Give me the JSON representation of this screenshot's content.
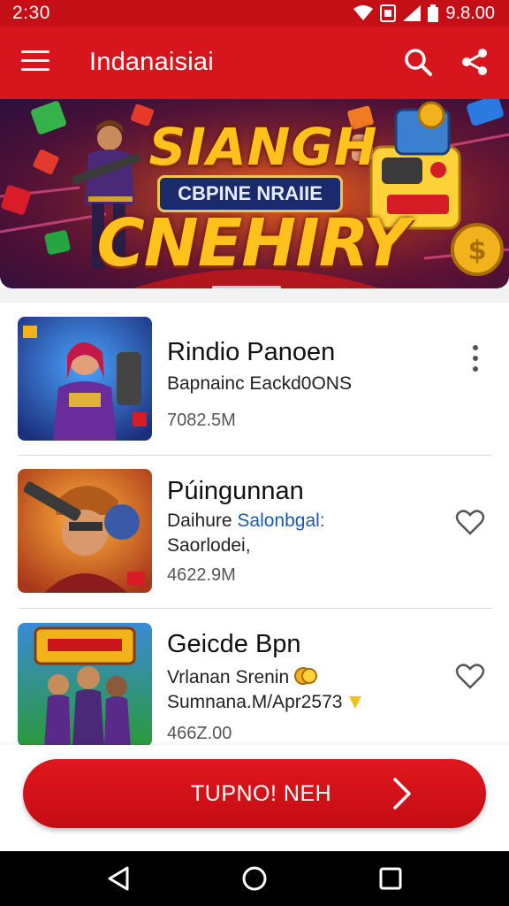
{
  "status_bar": {
    "time": "2:30",
    "battery_text": "9.8.00",
    "icons": [
      "wifi-icon",
      "sim-icon",
      "signal-icon",
      "battery-icon"
    ]
  },
  "app_bar": {
    "title": "Indanaisiai",
    "icons": [
      "menu-icon",
      "search-icon",
      "share-icon"
    ]
  },
  "banner": {
    "title_top": "SIANGH",
    "subtitle": "CBPINE NRAIIE",
    "title_bottom": "CNEHIRY"
  },
  "list": {
    "items": [
      {
        "title": "Rindio Panoen",
        "line1": "Bapnainc Eackd0ONS",
        "line2": "",
        "size": "7082.5M",
        "action": "more-vertical-icon"
      },
      {
        "title": "Púingunnan",
        "line1_a": "Daihure",
        "line1_b": "Salonbgal:",
        "line2": "Saorlodei,",
        "size": "4622.9M",
        "action": "heart-outline-icon"
      },
      {
        "title": "Geicde Bpn",
        "line1": "Vrlanan Srenin",
        "line2": "Sumnana.M/Apr2573",
        "size": "466Z.00",
        "action": "heart-outline-icon"
      }
    ]
  },
  "cta": {
    "label": "TUPNO! NEH",
    "icon": "chevron-right-icon"
  },
  "nav_bar": {
    "icons": [
      "back-icon",
      "home-icon",
      "recents-icon"
    ]
  },
  "colors": {
    "primary": "#d7151d",
    "status_bar": "#c50f17",
    "accent_text": "#1c5aa8"
  }
}
